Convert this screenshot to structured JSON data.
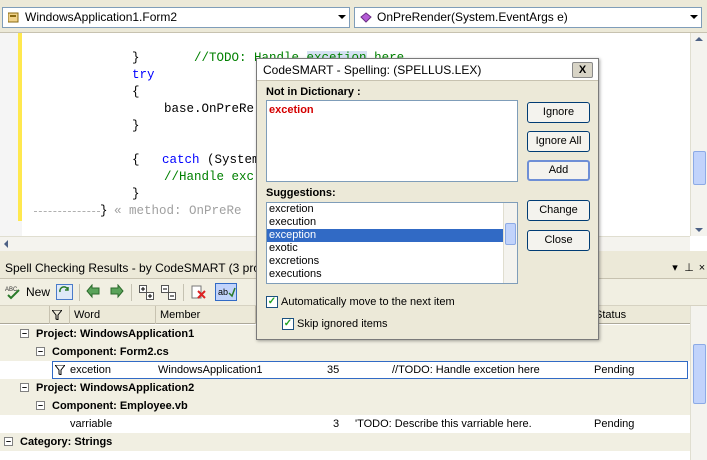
{
  "navbar": {
    "class_combo": "WindowsApplication1.Form2",
    "method_combo": "OnPreRender(System.EventArgs e)"
  },
  "editor": {
    "lines": [
      "//TODO: Handle ",
      "excetion",
      " here",
      "}",
      "try",
      "{",
      "base.OnPreRe",
      "}",
      "catch",
      " (System.",
      "Ex",
      "{",
      "//Handle exc",
      "}",
      "}",
      "« method: OnPreRe"
    ]
  },
  "panel": {
    "title": "Spell Checking Results - by CodeSMART (3 prob",
    "toolbar": {
      "new_label": "New"
    },
    "columns": {
      "word": "Word",
      "member": "Member",
      "status": "Status"
    },
    "rows": [
      {
        "type": "group",
        "label": "Project: WindowsApplication1"
      },
      {
        "type": "group",
        "label": "Component: Form2.cs"
      },
      {
        "type": "item",
        "word": "excetion",
        "member": "WindowsApplication1",
        "line": "35",
        "context": "//TODO: Handle excetion here",
        "status": "Pending"
      },
      {
        "type": "group",
        "label": "Project: WindowsApplication2"
      },
      {
        "type": "group",
        "label": "Component: Employee.vb"
      },
      {
        "type": "item",
        "word": "varriable",
        "member": "",
        "line": "3",
        "context": "'TODO: Describe this varriable here.",
        "status": "Pending"
      },
      {
        "type": "group",
        "label": "Category: Strings"
      }
    ]
  },
  "dialog": {
    "title": "CodeSMART - Spelling: (SPELLUS.LEX)",
    "not_in_dictionary_label": "Not in Dictionary :",
    "not_in_dictionary_value": "excetion",
    "suggestions_label": "Suggestions:",
    "suggestions": [
      "excretion",
      "execution",
      "exception",
      "exotic",
      "excretions",
      "executions"
    ],
    "selected_suggestion": "exception",
    "buttons": {
      "ignore": "Ignore",
      "ignore_all": "Ignore All",
      "add": "Add",
      "change": "Change",
      "close": "Close"
    },
    "auto_move_label": "Automatically move to the next item",
    "skip_ignored_label": "Skip ignored items",
    "auto_move_checked": true,
    "skip_ignored_checked": true,
    "close_glyph": "X"
  }
}
